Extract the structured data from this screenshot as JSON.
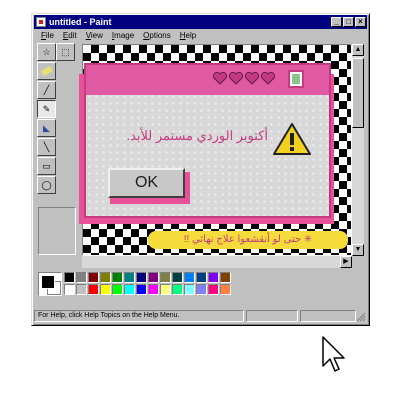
{
  "window": {
    "title": "untitled - Paint",
    "buttons": [
      "minimize",
      "maximize",
      "close"
    ]
  },
  "menu": [
    {
      "label": "File",
      "accel": "F",
      "rest": "ile"
    },
    {
      "label": "Edit",
      "accel": "E",
      "rest": "dit"
    },
    {
      "label": "View",
      "accel": "V",
      "rest": "iew"
    },
    {
      "label": "Image",
      "accel": "I",
      "rest": "mage"
    },
    {
      "label": "Options",
      "accel": "O",
      "rest": "ptions"
    },
    {
      "label": "Help",
      "accel": "H",
      "rest": "elp"
    }
  ],
  "toolbox": {
    "tools": [
      "free-select",
      "rect-select",
      "eraser",
      "fill",
      "eyedropper",
      "magnifier",
      "pencil",
      "brush",
      "airbrush",
      "text",
      "line",
      "curve",
      "rectangle",
      "polygon",
      "ellipse",
      "rounded-rectangle"
    ],
    "selected": "pencil"
  },
  "dialog": {
    "message": "أكتوبر الوردي مستمر للأبد.",
    "ok_label": "OK",
    "icon": "warning-icon",
    "banner": "✳ حتى لو أنقشعوا علاج نهائي !!"
  },
  "palette": {
    "foreground": "#000000",
    "background": "#ffffff",
    "colors_top": [
      "#000000",
      "#808080",
      "#800000",
      "#808000",
      "#008000",
      "#008080",
      "#000080",
      "#800080",
      "#808040",
      "#004040",
      "#0080ff",
      "#004080",
      "#8000ff",
      "#804000"
    ],
    "colors_bottom": [
      "#ffffff",
      "#c0c0c0",
      "#ff0000",
      "#ffff00",
      "#00ff00",
      "#00ffff",
      "#0000ff",
      "#ff00ff",
      "#ffff80",
      "#00ff80",
      "#80ffff",
      "#8080ff",
      "#ff0080",
      "#ff8040"
    ]
  },
  "status": {
    "text": "For Help, click Help Topics on the Help Menu."
  },
  "colors": {
    "title_bar": "#000080",
    "pink": "#df5aa2",
    "banner": "#f6dc3a"
  }
}
